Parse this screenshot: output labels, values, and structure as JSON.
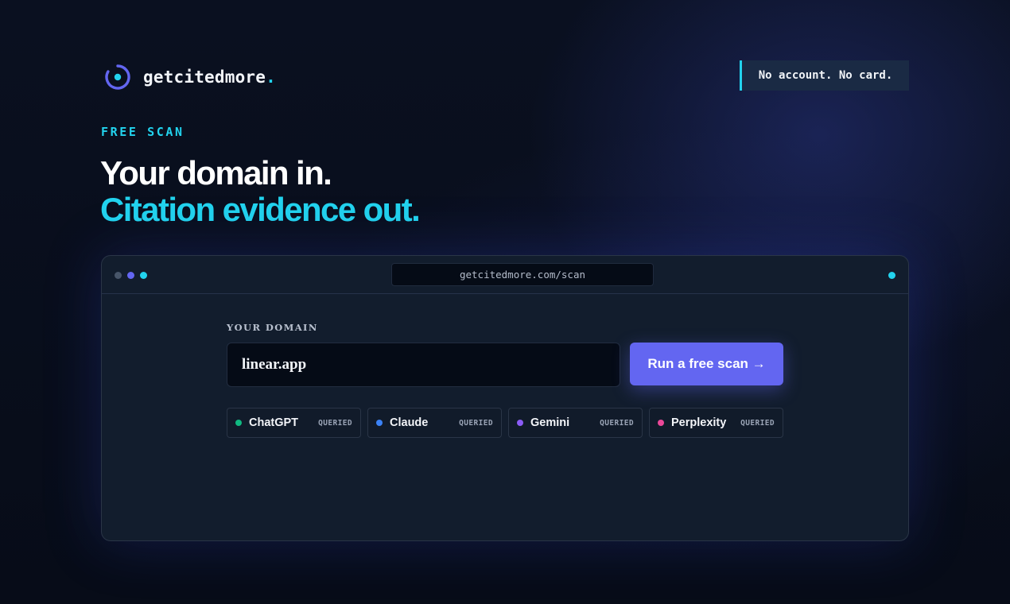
{
  "brand": {
    "name": "getcitedmore",
    "dot": ".",
    "icon": "target-ring-icon",
    "colors": {
      "ring": "#6366f1",
      "center": "#22d3ee"
    }
  },
  "badge": "No account. No card.",
  "eyebrow": "FREE SCAN",
  "headline": {
    "line1": "Your domain in.",
    "line2": "Citation evidence out."
  },
  "window": {
    "url": "getcitedmore.com/scan",
    "dots": [
      "#475569",
      "#6366f1",
      "#22d3ee"
    ],
    "status_color": "#22d3ee"
  },
  "form": {
    "label": "YOUR DOMAIN",
    "value": "linear.app",
    "button": "Run a free scan →"
  },
  "engines": [
    {
      "name": "ChatGPT",
      "status": "QUERIED",
      "color": "#10b981"
    },
    {
      "name": "Claude",
      "status": "QUERIED",
      "color": "#3b82f6"
    },
    {
      "name": "Gemini",
      "status": "QUERIED",
      "color": "#8b5cf6"
    },
    {
      "name": "Perplexity",
      "status": "QUERIED",
      "color": "#ec4899"
    }
  ],
  "colors": {
    "accent": "#22d3ee",
    "primary": "#6366f1",
    "background": "#070c18"
  }
}
